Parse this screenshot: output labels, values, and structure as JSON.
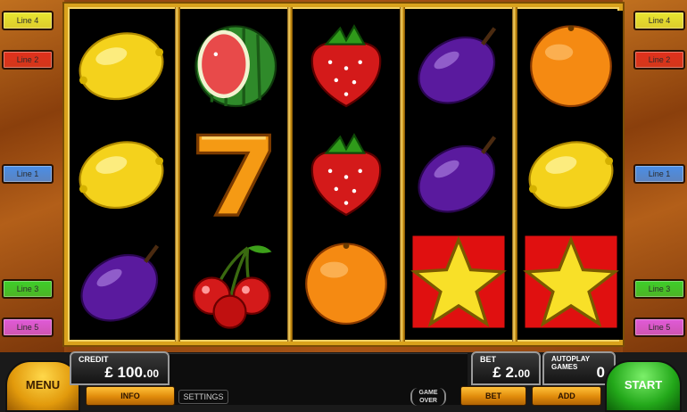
{
  "lines_left": [
    {
      "label": "Line 4",
      "color": "#e8e630"
    },
    {
      "label": "Line 2",
      "color": "#e0301c"
    },
    {
      "label": "Line 1",
      "color": "#4a8fe8"
    },
    {
      "label": "Line 3",
      "color": "#3ccf2a"
    },
    {
      "label": "Line 5",
      "color": "#e05ad8"
    }
  ],
  "lines_right": [
    {
      "label": "Line 4",
      "color": "#e8e630"
    },
    {
      "label": "Line 2",
      "color": "#e0301c"
    },
    {
      "label": "Line 1",
      "color": "#4a8fe8"
    },
    {
      "label": "Line 3",
      "color": "#3ccf2a"
    },
    {
      "label": "Line 5",
      "color": "#e05ad8"
    }
  ],
  "reels": [
    [
      "lemon",
      "lemon",
      "plum"
    ],
    [
      "watermelon",
      "seven",
      "cherries"
    ],
    [
      "strawberry",
      "strawberry",
      "orange"
    ],
    [
      "plum",
      "plum",
      "star"
    ],
    [
      "orange",
      "lemon",
      "star"
    ]
  ],
  "panel": {
    "menu_label": "MENU",
    "credit_label": "CREDIT",
    "credit_value": "£ 100.",
    "credit_cents": "00",
    "info_label": "INFO",
    "settings_label": "SETTINGS",
    "gameover_line1": "GAME",
    "gameover_line2": "OVER",
    "bet_label": "BET",
    "bet_value": "£ 2.",
    "bet_cents": "00",
    "bet_button_label": "BET",
    "autoplay_label": "AUTOPLAY GAMES",
    "autoplay_value": "0",
    "add_label": "ADD",
    "start_label": "START"
  }
}
